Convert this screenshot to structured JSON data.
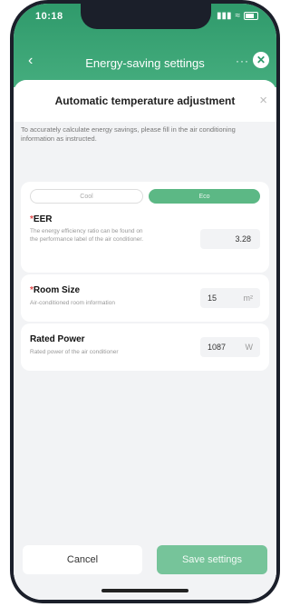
{
  "status_bar": {
    "time": "10:18"
  },
  "nav": {
    "back_icon": "chevron-left-icon",
    "title": "Energy-saving settings",
    "more": "···",
    "close": "⊗"
  },
  "sheet": {
    "title": "Automatic temperature adjustment",
    "close": "×",
    "instructions": "To accurately calculate energy savings, please fill in the air conditioning information as instructed."
  },
  "mode_toggle": {
    "options": [
      "Cool",
      "Eco"
    ],
    "selected": "Eco"
  },
  "fields": {
    "eer": {
      "label": "EER",
      "required_mark": "*",
      "description": "The energy efficiency ratio can be found on the performance label of the air conditioner.",
      "value": "3.28"
    },
    "room_size": {
      "label": "Room Size",
      "required_mark": "*",
      "description": "Air-conditioned room information",
      "value": "15",
      "unit": "m²"
    },
    "rated_power": {
      "label": "Rated Power",
      "description": "Rated power of the air conditioner",
      "value": "1087",
      "unit": "W"
    }
  },
  "footer": {
    "cancel": "Cancel",
    "save": "Save settings"
  },
  "colors": {
    "brand_green": "#2f9a6b",
    "toggle_active": "#5cb885",
    "save_button": "#76c49a",
    "required": "#e24b4b"
  }
}
